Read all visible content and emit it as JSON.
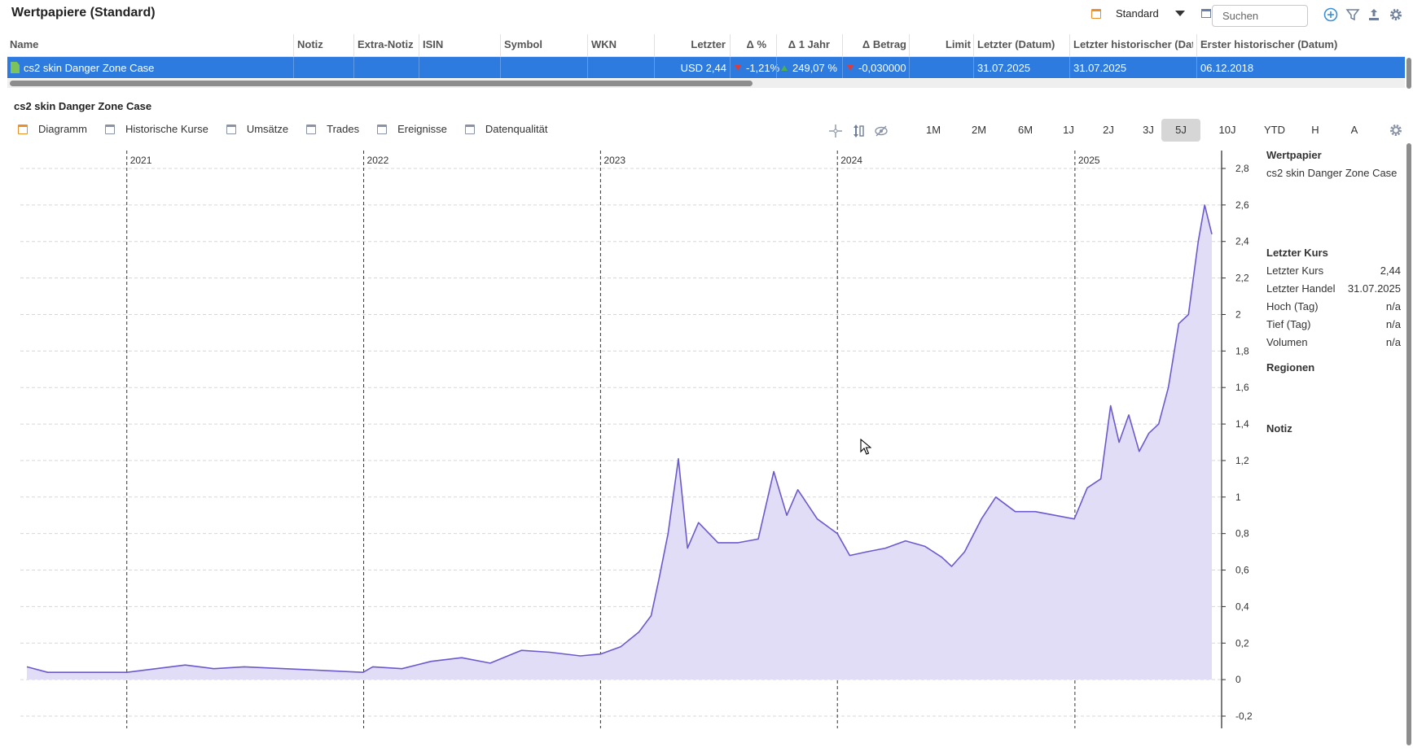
{
  "header": {
    "title": "Wertpapiere (Standard)",
    "view_label": "Standard",
    "search_placeholder": "Suchen"
  },
  "table": {
    "columns": [
      "Name",
      "Notiz",
      "Extra-Notiz",
      "ISIN",
      "Symbol",
      "WKN",
      "Letzter",
      "Δ %",
      "Δ 1 Jahr",
      "Δ Betrag",
      "Limit",
      "Letzter (Datum)",
      "Letzter historischer (Datum)",
      "Erster historischer (Datum)"
    ],
    "row": {
      "name": "cs2 skin Danger Zone Case",
      "notiz": "",
      "extra_notiz": "",
      "isin": "",
      "symbol": "",
      "wkn": "",
      "letzter": "USD 2,44",
      "delta_pct": "-1,21%",
      "delta_1y": "249,07 %",
      "delta_betrag": "-0,030000",
      "limit": "",
      "letzter_datum": "31.07.2025",
      "letzter_hist_datum": "31.07.2025",
      "erster_hist_datum": "06.12.2018"
    }
  },
  "detail": {
    "title": "cs2 skin Danger Zone Case",
    "tabs": [
      "Diagramm",
      "Historische Kurse",
      "Umsätze",
      "Trades",
      "Ereignisse",
      "Datenqualität"
    ],
    "ranges": [
      "1M",
      "2M",
      "6M",
      "1J",
      "2J",
      "3J",
      "5J",
      "10J",
      "YTD",
      "H",
      "A"
    ],
    "active_range": "5J"
  },
  "side_panel": {
    "wertpapier_heading": "Wertpapier",
    "wertpapier_name": "cs2 skin Danger Zone Case",
    "letzter_kurs_heading": "Letzter Kurs",
    "rows": [
      {
        "label": "Letzter Kurs",
        "value": "2,44"
      },
      {
        "label": "Letzter Handel",
        "value": "31.07.2025"
      },
      {
        "label": "Hoch (Tag)",
        "value": "n/a"
      },
      {
        "label": "Tief (Tag)",
        "value": "n/a"
      },
      {
        "label": "Volumen",
        "value": "n/a"
      }
    ],
    "regionen_heading": "Regionen",
    "notiz_heading": "Notiz"
  },
  "colors": {
    "selection": "#2e7be0",
    "line": "#6a5acd",
    "fill": "#e1ddf6",
    "accent_icon": "#3a8fd6",
    "calendar_icon": "#e8912c"
  },
  "chart_data": {
    "type": "area",
    "ylim": [
      -0.2,
      2.8
    ],
    "yticks": [
      "2,8",
      "2,6",
      "2,4",
      "2,2",
      "2",
      "1,8",
      "1,6",
      "1,4",
      "1,2",
      "1",
      "0,8",
      "0,6",
      "0,4",
      "0,2",
      "0",
      "-0,2"
    ],
    "xticks": [
      "2021",
      "2022",
      "2023",
      "2024",
      "2025"
    ],
    "xlim": [
      "2020-07-31",
      "2025-07-31"
    ],
    "grid": true,
    "x": [
      "2020-07-31",
      "2020-09-01",
      "2020-11-01",
      "2021-01-01",
      "2021-02-15",
      "2021-04-01",
      "2021-05-15",
      "2021-07-01",
      "2021-09-01",
      "2021-11-01",
      "2021-12-31",
      "2022-01-15",
      "2022-03-01",
      "2022-04-15",
      "2022-06-01",
      "2022-07-15",
      "2022-09-01",
      "2022-10-15",
      "2022-12-01",
      "2023-01-01",
      "2023-02-01",
      "2023-03-01",
      "2023-03-20",
      "2023-04-01",
      "2023-04-15",
      "2023-05-01",
      "2023-05-15",
      "2023-06-01",
      "2023-07-01",
      "2023-08-01",
      "2023-09-01",
      "2023-09-25",
      "2023-10-15",
      "2023-11-01",
      "2023-12-01",
      "2024-01-01",
      "2024-01-20",
      "2024-02-15",
      "2024-03-15",
      "2024-04-15",
      "2024-05-15",
      "2024-06-10",
      "2024-06-25",
      "2024-07-15",
      "2024-08-10",
      "2024-09-01",
      "2024-10-01",
      "2024-11-01",
      "2024-12-01",
      "2024-12-31",
      "2025-01-20",
      "2025-02-10",
      "2025-02-25",
      "2025-03-10",
      "2025-03-25",
      "2025-04-10",
      "2025-04-25",
      "2025-05-10",
      "2025-05-25",
      "2025-06-10",
      "2025-06-25",
      "2025-07-10",
      "2025-07-20",
      "2025-07-31"
    ],
    "y": [
      0.07,
      0.04,
      0.04,
      0.04,
      0.06,
      0.08,
      0.06,
      0.07,
      0.06,
      0.05,
      0.04,
      0.07,
      0.06,
      0.1,
      0.12,
      0.09,
      0.16,
      0.15,
      0.13,
      0.14,
      0.18,
      0.26,
      0.35,
      0.55,
      0.8,
      1.21,
      0.72,
      0.86,
      0.75,
      0.75,
      0.77,
      1.14,
      0.9,
      1.04,
      0.88,
      0.8,
      0.68,
      0.7,
      0.72,
      0.76,
      0.73,
      0.67,
      0.62,
      0.7,
      0.88,
      1.0,
      0.92,
      0.92,
      0.9,
      0.88,
      1.05,
      1.1,
      1.5,
      1.3,
      1.45,
      1.25,
      1.35,
      1.4,
      1.6,
      1.95,
      2.0,
      2.4,
      2.6,
      2.44
    ]
  }
}
